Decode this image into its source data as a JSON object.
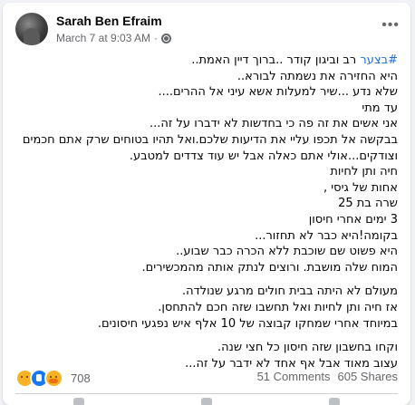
{
  "post": {
    "author": "Sarah Ben Efraim",
    "timestamp": "March 7 at 9:03 AM",
    "separator": "·",
    "more_icon": "more-horizontal-icon",
    "privacy_icon": "globe-icon",
    "hashtag": "#בצער",
    "body_lines": [
      {
        "after_hashtag": " רב וביגון קודר ..ברוך דיין האמת..",
        "has_hashtag": true
      },
      {
        "text": "היא החזירה את נשמתה לבורא.."
      },
      {
        "text": "שלא נדע ...שיר למעלות אשא עיני אל ההרים...."
      },
      {
        "text": "עד מתי"
      },
      {
        "text": "אני אשים את זה פה כי בחדשות לא ידברו על זה..."
      },
      {
        "text": "בבקשה אל תכפו עליי את הדיעות שלכם.ואל תהיו בטוחים שרק אתם חכמים"
      },
      {
        "text": "וצודקים...אולי אתם כאלה אבל יש עוד צדדים למטבע."
      },
      {
        "text": "חיה ותן לחיות"
      },
      {
        "text": "אחות של גיסי ,"
      },
      {
        "text": "שרה בת 25"
      },
      {
        "text": "3 ימים אחרי חיסון"
      },
      {
        "text": "בקומה!היא כבר לא תחזור..."
      },
      {
        "text": "היא פשוט שם שוכבת ללא הכרה כבר שבוע.."
      },
      {
        "text": "המוח שלה מושבת. ורוצים לנתק אותה מהמכשירים."
      },
      {
        "text": ""
      },
      {
        "text": "מעולם לא היתה בבית חולים מרגע שנולדה."
      },
      {
        "text": "אז חיה ותן לחיות ואל תחשבו שזה חכם להתחסן."
      },
      {
        "text": "במיוחד אחרי שמחקו קבוצה של 10 אלף איש נפגעי חיסונים."
      },
      {
        "text": ""
      },
      {
        "text": "וקחו בחשבון שזה חיסון כל חצי שנה."
      },
      {
        "text": "עצוב מאוד אבל אף אחד לא ידבר על זה..."
      }
    ]
  },
  "engagement": {
    "reaction_icons": [
      "sad-reaction-icon",
      "like-reaction-icon",
      "care-reaction-icon"
    ],
    "reaction_count": "708",
    "comments": "51 Comments",
    "shares": "605 Shares"
  },
  "colors": {
    "hashtag": "#216fdb",
    "secondary_text": "#65676b",
    "background": "#f0f2f5"
  }
}
